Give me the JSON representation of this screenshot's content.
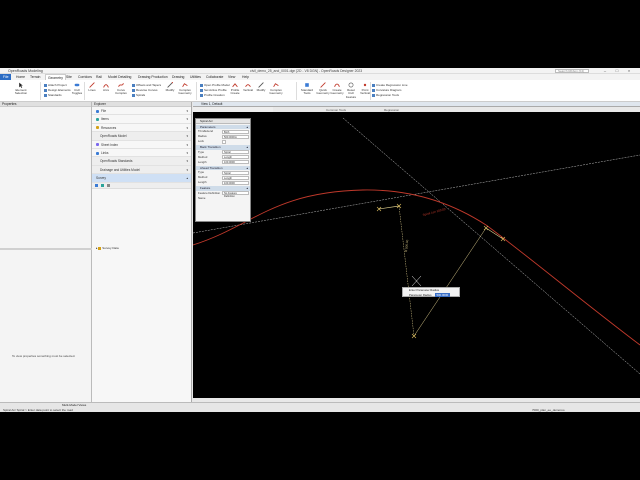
{
  "window": {
    "app_name": "OpenRoads Modeling",
    "title": "civil_demo_25_and_0001.dgn [2D - V8 DGN] - OpenRoads Designer 2023",
    "search_placeholder": "Search Ribbon (F4)"
  },
  "tabs": [
    "File",
    "Home",
    "Terrain",
    "Geometry",
    "Site",
    "Corridors",
    "Rail",
    "Model Detailing",
    "Drawing Production",
    "Drawing",
    "Utilities",
    "Collaborate",
    "View",
    "Help"
  ],
  "ribbon": {
    "buttons": [
      "Element Selection",
      "Civil Toggles",
      "Lines",
      "Arcs",
      "Curve Complex",
      "Modify",
      "Complex Geometry",
      "Profile Create",
      "Vertical",
      "Modify",
      "Complex Geometry",
      "Standard Tools",
      "Quick Geometry",
      "Create Geometry",
      "Reset Civil Feature",
      "Point Vertical",
      "Create Regression Line"
    ],
    "small_items": [
      "Attach Project",
      "Design Elements",
      "Standards",
      "Offsets and Tapers",
      "Reverse Curves",
      "Spirals",
      "Open Profile Model",
      "Set Active Profile",
      "Profile Creation",
      "Curvature Diagram",
      "Regression Tools"
    ],
    "groups": [
      "Primary",
      "Selection",
      "General Tools",
      "Horizontal",
      "Vertical",
      "Common Tools",
      "Regression"
    ]
  },
  "properties": {
    "title": "Properties",
    "empty_message": "To view properties something must be selected."
  },
  "explorer": {
    "title": "Explorer",
    "items": [
      "File",
      "Items",
      "Resources",
      "OpenRoads Model",
      "Sheet Index",
      "Links",
      "OpenRoads Standards",
      "Drainage and Utilities Model",
      "Survey"
    ],
    "tree_item": "Survey Data"
  },
  "view": {
    "title": "View 1, Default"
  },
  "spiral_dialog": {
    "title": "Spiral Arc",
    "sections": [
      "Parameters",
      "Back Transition",
      "Ahead Transition",
      "Feature"
    ],
    "params": [
      {
        "label": "Trim/Extend",
        "value": "Both"
      },
      {
        "label": "Radius",
        "value": "500.0000m"
      },
      {
        "label": "Lock",
        "value": ""
      }
    ],
    "back": [
      {
        "label": "Type",
        "value": "Spiral"
      },
      {
        "label": "Method",
        "value": "Length"
      },
      {
        "label": "Length",
        "value": "100.0000"
      }
    ],
    "ahead": [
      {
        "label": "Type",
        "value": "Spiral"
      },
      {
        "label": "Method",
        "value": "Length"
      },
      {
        "label": "Length",
        "value": "100.0000"
      }
    ],
    "feature": [
      {
        "label": "Feature Definition",
        "value": "No Feature Definition"
      },
      {
        "label": "Name",
        "value": ""
      }
    ]
  },
  "canvas_tip": {
    "line1": "Enter Parameter Radius",
    "line2_label": "Parameter Radius",
    "line2_value": "500.0000"
  },
  "status": {
    "prompt": "Spiral Arc Spiral > Enter data point to select the road",
    "view_name": "Multi-Model Views",
    "right": "7000_plan_ee_demoroo"
  },
  "colors": {
    "accent": "#2b6cc4",
    "curve": "#c0392b",
    "construction": "#d9c98a",
    "canvas": "#000000"
  }
}
